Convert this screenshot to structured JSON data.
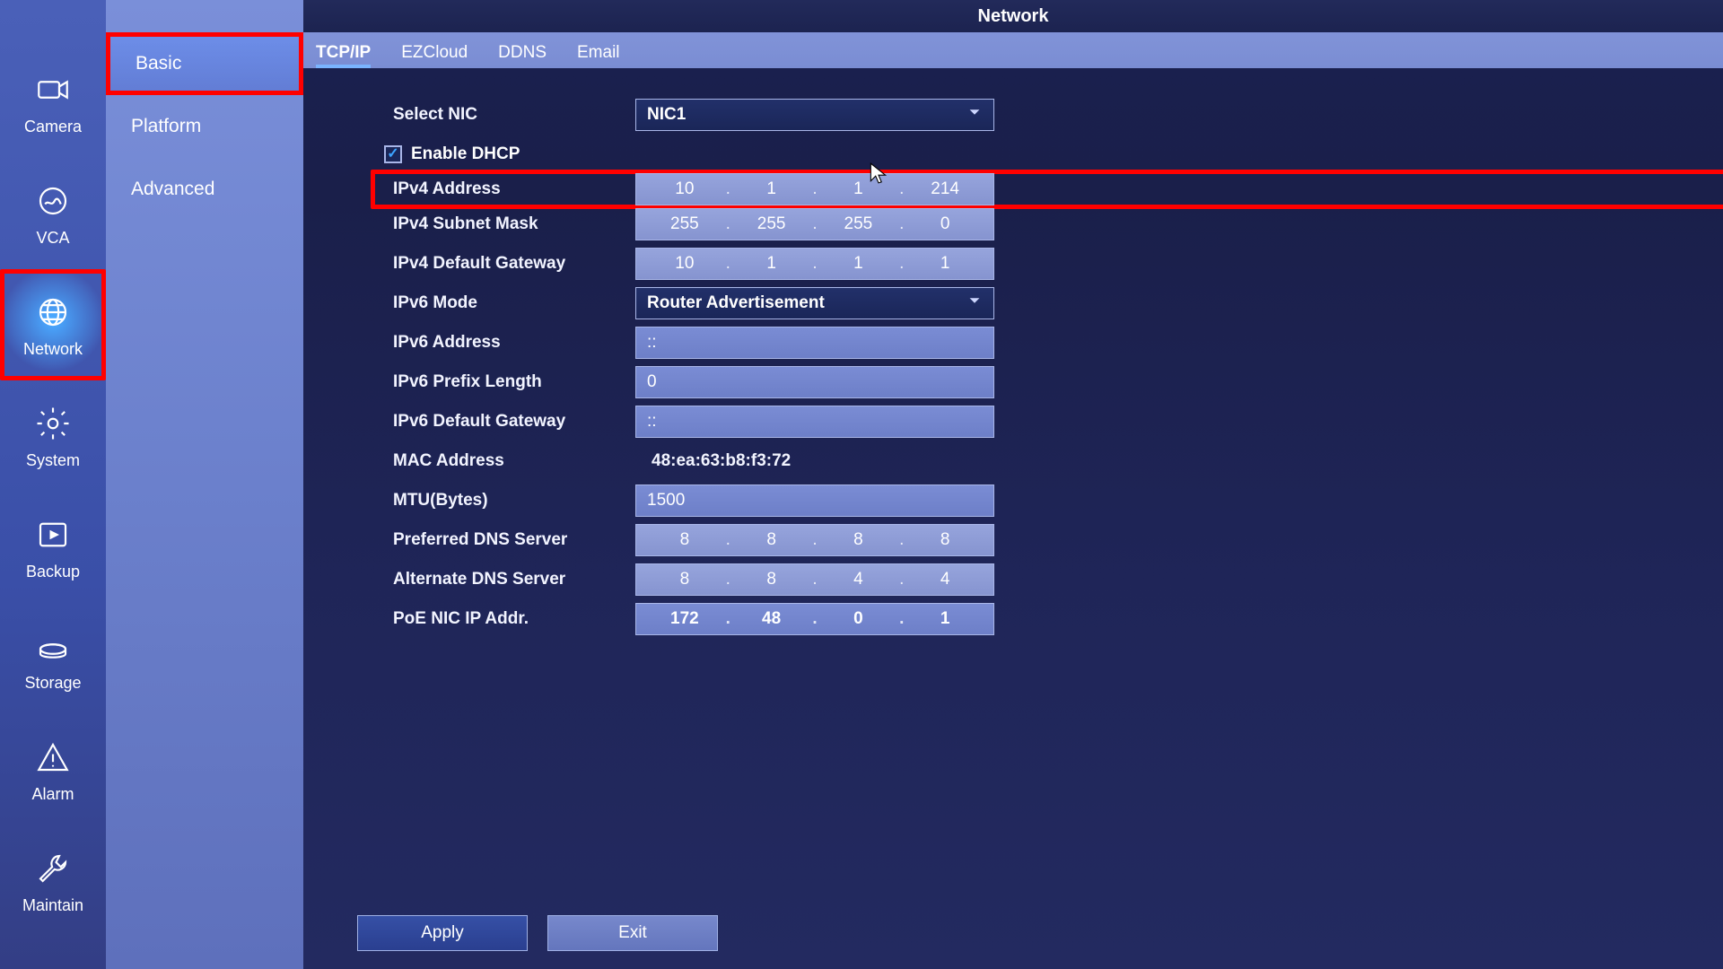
{
  "title": "Network",
  "iconbar": [
    {
      "name": "camera",
      "label": "Camera"
    },
    {
      "name": "vca",
      "label": "VCA"
    },
    {
      "name": "network",
      "label": "Network",
      "active": true,
      "highlight": true
    },
    {
      "name": "system",
      "label": "System"
    },
    {
      "name": "backup",
      "label": "Backup"
    },
    {
      "name": "storage",
      "label": "Storage"
    },
    {
      "name": "alarm",
      "label": "Alarm"
    },
    {
      "name": "maintain",
      "label": "Maintain"
    }
  ],
  "subnav": [
    {
      "label": "Basic",
      "highlight": true
    },
    {
      "label": "Platform"
    },
    {
      "label": "Advanced"
    }
  ],
  "tabs": [
    {
      "label": "TCP/IP",
      "active": true
    },
    {
      "label": "EZCloud"
    },
    {
      "label": "DDNS"
    },
    {
      "label": "Email"
    }
  ],
  "form": {
    "select_nic": {
      "label": "Select NIC",
      "value": "NIC1"
    },
    "enable_dhcp": {
      "label": "Enable DHCP",
      "checked": true
    },
    "ipv4_address": {
      "label": "IPv4 Address",
      "octets": [
        "10",
        "1",
        "1",
        "214"
      ],
      "highlight": true
    },
    "ipv4_subnet_mask": {
      "label": "IPv4 Subnet Mask",
      "octets": [
        "255",
        "255",
        "255",
        "0"
      ]
    },
    "ipv4_default_gateway": {
      "label": "IPv4 Default Gateway",
      "octets": [
        "10",
        "1",
        "1",
        "1"
      ]
    },
    "ipv6_mode": {
      "label": "IPv6 Mode",
      "value": "Router Advertisement"
    },
    "ipv6_address": {
      "label": "IPv6 Address",
      "value": "::"
    },
    "ipv6_prefix_length": {
      "label": "IPv6 Prefix Length",
      "value": "0"
    },
    "ipv6_default_gateway": {
      "label": "IPv6 Default Gateway",
      "value": "::"
    },
    "mac_address": {
      "label": "MAC Address",
      "value": "48:ea:63:b8:f3:72"
    },
    "mtu": {
      "label": "MTU(Bytes)",
      "value": "1500"
    },
    "preferred_dns": {
      "label": "Preferred DNS Server",
      "octets": [
        "8",
        "8",
        "8",
        "8"
      ]
    },
    "alternate_dns": {
      "label": "Alternate DNS Server",
      "octets": [
        "8",
        "8",
        "4",
        "4"
      ]
    },
    "poe_nic_ip": {
      "label": "PoE NIC IP Addr.",
      "octets": [
        "172",
        "48",
        "0",
        "1"
      ],
      "bold_dots": true
    }
  },
  "buttons": {
    "apply": "Apply",
    "exit": "Exit"
  }
}
